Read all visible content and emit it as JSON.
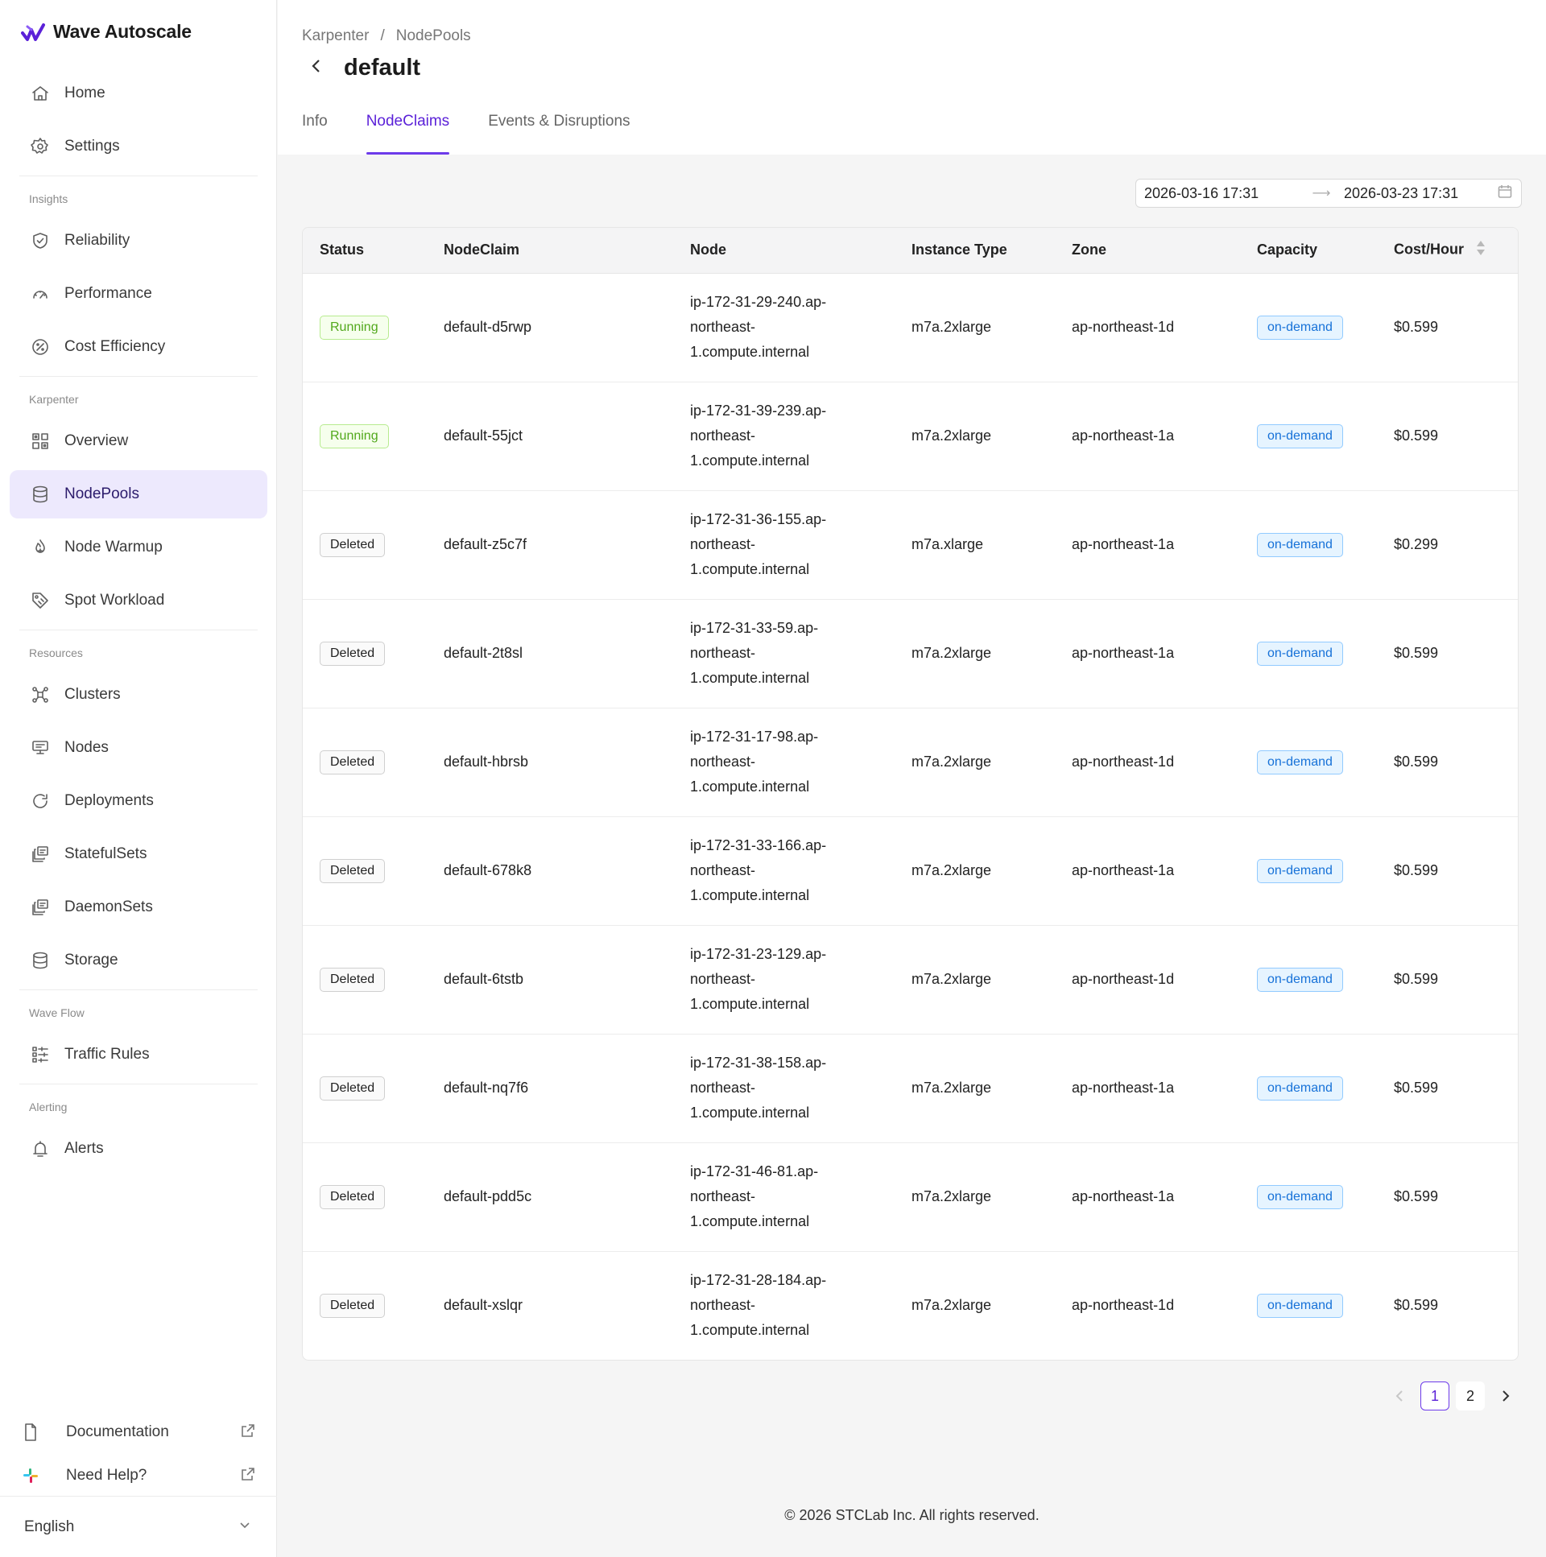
{
  "app": {
    "name": "Wave Autoscale"
  },
  "sidebar": {
    "top": [
      {
        "label": "Home",
        "icon": "home-icon"
      },
      {
        "label": "Settings",
        "icon": "gear-icon"
      }
    ],
    "sections": [
      {
        "title": "Insights",
        "items": [
          {
            "label": "Reliability",
            "icon": "shield-check-icon"
          },
          {
            "label": "Performance",
            "icon": "gauge-icon"
          },
          {
            "label": "Cost Efficiency",
            "icon": "cost-icon"
          }
        ]
      },
      {
        "title": "Karpenter",
        "items": [
          {
            "label": "Overview",
            "icon": "grid-icon"
          },
          {
            "label": "NodePools",
            "icon": "database-icon",
            "active": true
          },
          {
            "label": "Node Warmup",
            "icon": "flame-icon"
          },
          {
            "label": "Spot Workload",
            "icon": "tag-icon"
          }
        ]
      },
      {
        "title": "Resources",
        "items": [
          {
            "label": "Clusters",
            "icon": "cluster-icon"
          },
          {
            "label": "Nodes",
            "icon": "node-icon"
          },
          {
            "label": "Deployments",
            "icon": "refresh-icon"
          },
          {
            "label": "StatefulSets",
            "icon": "stack-icon"
          },
          {
            "label": "DaemonSets",
            "icon": "stack-icon"
          },
          {
            "label": "Storage",
            "icon": "database-icon"
          }
        ]
      },
      {
        "title": "Wave Flow",
        "items": [
          {
            "label": "Traffic Rules",
            "icon": "rules-icon"
          }
        ]
      },
      {
        "title": "Alerting",
        "items": [
          {
            "label": "Alerts",
            "icon": "bell-icon"
          }
        ]
      }
    ],
    "bottom": {
      "documentation": "Documentation",
      "help": "Need Help?",
      "language": "English"
    }
  },
  "header": {
    "breadcrumb": [
      "Karpenter",
      "NodePools"
    ],
    "breadcrumb_sep": "/",
    "title": "default",
    "tabs": [
      {
        "label": "Info"
      },
      {
        "label": "NodeClaims",
        "active": true
      },
      {
        "label": "Events & Disruptions"
      }
    ]
  },
  "date_range": {
    "start": "2026-03-16 17:31",
    "end": "2026-03-23 17:31"
  },
  "table": {
    "columns": [
      "Status",
      "NodeClaim",
      "Node",
      "Instance Type",
      "Zone",
      "Capacity",
      "Cost/Hour"
    ],
    "rows": [
      {
        "status": "Running",
        "nodeclaim": "default-d5rwp",
        "node": "ip-172-31-29-240.ap-northeast-1.compute.internal",
        "instance": "m7a.2xlarge",
        "zone": "ap-northeast-1d",
        "capacity": "on-demand",
        "cost": "$0.599"
      },
      {
        "status": "Running",
        "nodeclaim": "default-55jct",
        "node": "ip-172-31-39-239.ap-northeast-1.compute.internal",
        "instance": "m7a.2xlarge",
        "zone": "ap-northeast-1a",
        "capacity": "on-demand",
        "cost": "$0.599"
      },
      {
        "status": "Deleted",
        "nodeclaim": "default-z5c7f",
        "node": "ip-172-31-36-155.ap-northeast-1.compute.internal",
        "instance": "m7a.xlarge",
        "zone": "ap-northeast-1a",
        "capacity": "on-demand",
        "cost": "$0.299"
      },
      {
        "status": "Deleted",
        "nodeclaim": "default-2t8sl",
        "node": "ip-172-31-33-59.ap-northeast-1.compute.internal",
        "instance": "m7a.2xlarge",
        "zone": "ap-northeast-1a",
        "capacity": "on-demand",
        "cost": "$0.599"
      },
      {
        "status": "Deleted",
        "nodeclaim": "default-hbrsb",
        "node": "ip-172-31-17-98.ap-northeast-1.compute.internal",
        "instance": "m7a.2xlarge",
        "zone": "ap-northeast-1d",
        "capacity": "on-demand",
        "cost": "$0.599"
      },
      {
        "status": "Deleted",
        "nodeclaim": "default-678k8",
        "node": "ip-172-31-33-166.ap-northeast-1.compute.internal",
        "instance": "m7a.2xlarge",
        "zone": "ap-northeast-1a",
        "capacity": "on-demand",
        "cost": "$0.599"
      },
      {
        "status": "Deleted",
        "nodeclaim": "default-6tstb",
        "node": "ip-172-31-23-129.ap-northeast-1.compute.internal",
        "instance": "m7a.2xlarge",
        "zone": "ap-northeast-1d",
        "capacity": "on-demand",
        "cost": "$0.599"
      },
      {
        "status": "Deleted",
        "nodeclaim": "default-nq7f6",
        "node": "ip-172-31-38-158.ap-northeast-1.compute.internal",
        "instance": "m7a.2xlarge",
        "zone": "ap-northeast-1a",
        "capacity": "on-demand",
        "cost": "$0.599"
      },
      {
        "status": "Deleted",
        "nodeclaim": "default-pdd5c",
        "node": "ip-172-31-46-81.ap-northeast-1.compute.internal",
        "instance": "m7a.2xlarge",
        "zone": "ap-northeast-1a",
        "capacity": "on-demand",
        "cost": "$0.599"
      },
      {
        "status": "Deleted",
        "nodeclaim": "default-xslqr",
        "node": "ip-172-31-28-184.ap-northeast-1.compute.internal",
        "instance": "m7a.2xlarge",
        "zone": "ap-northeast-1d",
        "capacity": "on-demand",
        "cost": "$0.599"
      }
    ]
  },
  "pagination": {
    "pages": [
      "1",
      "2"
    ],
    "current": "1"
  },
  "footer": {
    "copyright": "© 2026 STCLab Inc. All rights reserved."
  },
  "colors": {
    "accent": "#6d3bea",
    "running": "#52a81c",
    "capacity": "#1671d8"
  }
}
